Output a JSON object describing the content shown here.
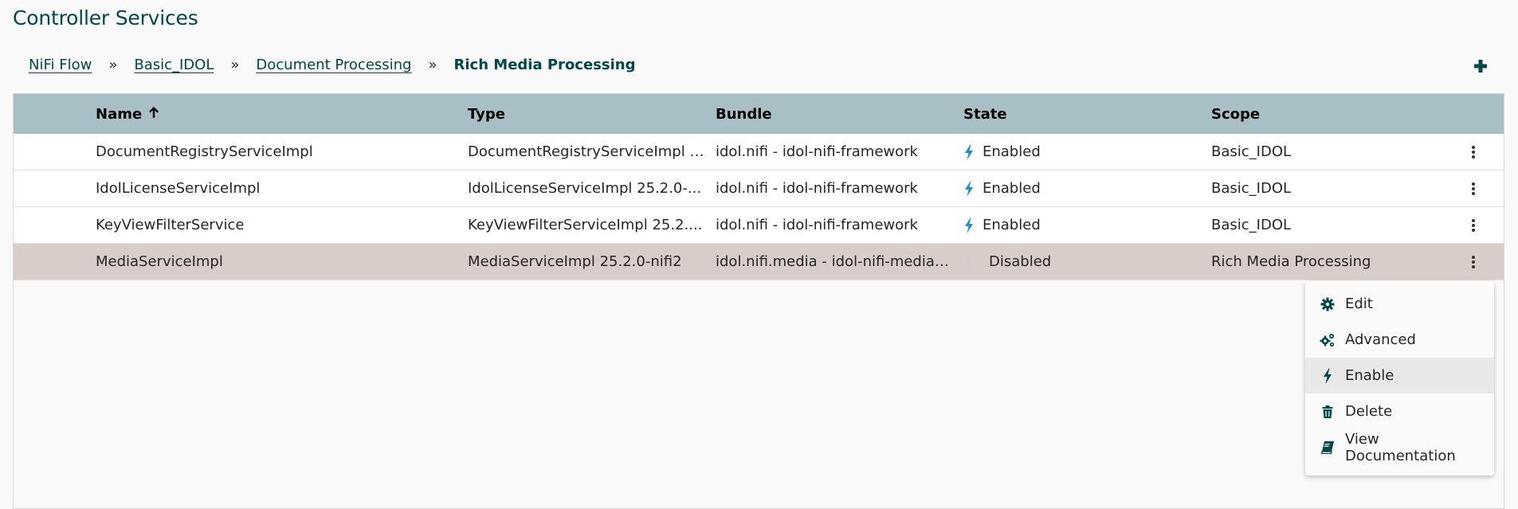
{
  "page": {
    "title": "Controller Services"
  },
  "breadcrumb": {
    "items": [
      "NiFi Flow",
      "Basic_IDOL",
      "Document Processing"
    ],
    "separator": "»",
    "current": "Rich Media Processing"
  },
  "toolbar": {
    "add_icon": "plus-icon"
  },
  "table": {
    "headers": {
      "name": "Name",
      "type": "Type",
      "bundle": "Bundle",
      "state": "State",
      "scope": "Scope"
    },
    "sort": {
      "column": "Name",
      "direction": "ascending"
    },
    "rows": [
      {
        "name": "DocumentRegistryServiceImpl",
        "type": "DocumentRegistryServiceImpl 2...",
        "bundle": "idol.nifi - idol-nifi-framework",
        "state": "Enabled",
        "scope": "Basic_IDOL"
      },
      {
        "name": "IdolLicenseServiceImpl",
        "type": "IdolLicenseServiceImpl 25.2.0-...",
        "bundle": "idol.nifi - idol-nifi-framework",
        "state": "Enabled",
        "scope": "Basic_IDOL"
      },
      {
        "name": "KeyViewFilterService",
        "type": "KeyViewFilterServiceImpl 25.2....",
        "bundle": "idol.nifi - idol-nifi-framework",
        "state": "Enabled",
        "scope": "Basic_IDOL"
      },
      {
        "name": "MediaServiceImpl",
        "type": "MediaServiceImpl 25.2.0-nifi2",
        "bundle": "idol.nifi.media - idol-nifi-media-...",
        "state": "Disabled",
        "scope": "Rich Media Processing"
      }
    ]
  },
  "context_menu": {
    "items": [
      {
        "label": "Edit",
        "icon": "gear-icon"
      },
      {
        "label": "Advanced",
        "icon": "gears-icon"
      },
      {
        "label": "Enable",
        "icon": "bolt-icon"
      },
      {
        "label": "Delete",
        "icon": "trash-icon"
      },
      {
        "label": "View Documentation",
        "icon": "book-icon"
      }
    ]
  },
  "colors": {
    "accent": "#004849",
    "header_bg": "#a8bfc6",
    "selected_row": "#d8cdc9",
    "enabled_bolt": "#1491d2",
    "disabled_bolt": "#cccccc"
  }
}
